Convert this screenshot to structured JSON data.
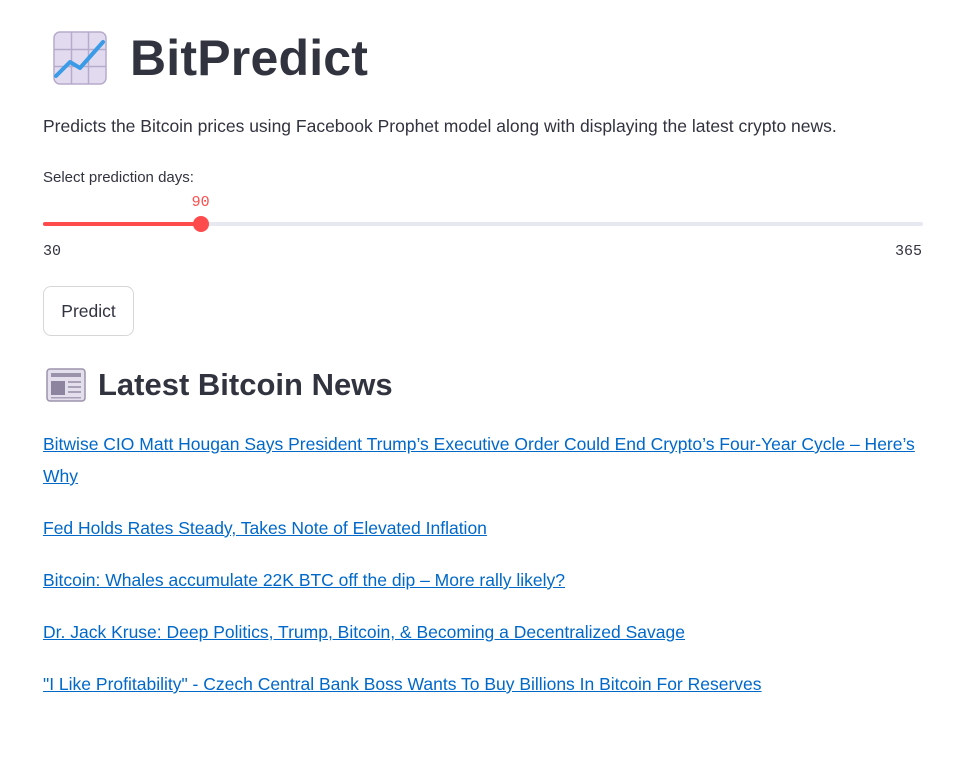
{
  "app": {
    "title": "BitPredict",
    "subtitle": "Predicts the Bitcoin prices using Facebook Prophet model along with displaying the latest crypto news.",
    "title_icon": "chart-increasing-icon"
  },
  "slider": {
    "label": "Select prediction days:",
    "value": "90",
    "min": "30",
    "max": "365",
    "accent_color": "#ff4b4b"
  },
  "predict_button": {
    "label": "Predict"
  },
  "news": {
    "icon": "newspaper-icon",
    "title": "Latest Bitcoin News",
    "link_color": "#0068c9",
    "items": [
      {
        "title": "Bitwise CIO Matt Hougan Says President Trump’s Executive Order Could End Crypto’s Four-Year Cycle – Here’s Why"
      },
      {
        "title": "Fed Holds Rates Steady, Takes Note of Elevated Inflation"
      },
      {
        "title": "Bitcoin: Whales accumulate 22K BTC off the dip – More rally likely?"
      },
      {
        "title": "Dr. Jack Kruse: Deep Politics, Trump, Bitcoin, & Becoming a Decentralized Savage"
      },
      {
        "title": "\"I Like Profitability\" - Czech Central Bank Boss Wants To Buy Billions In Bitcoin For Reserves"
      }
    ]
  }
}
